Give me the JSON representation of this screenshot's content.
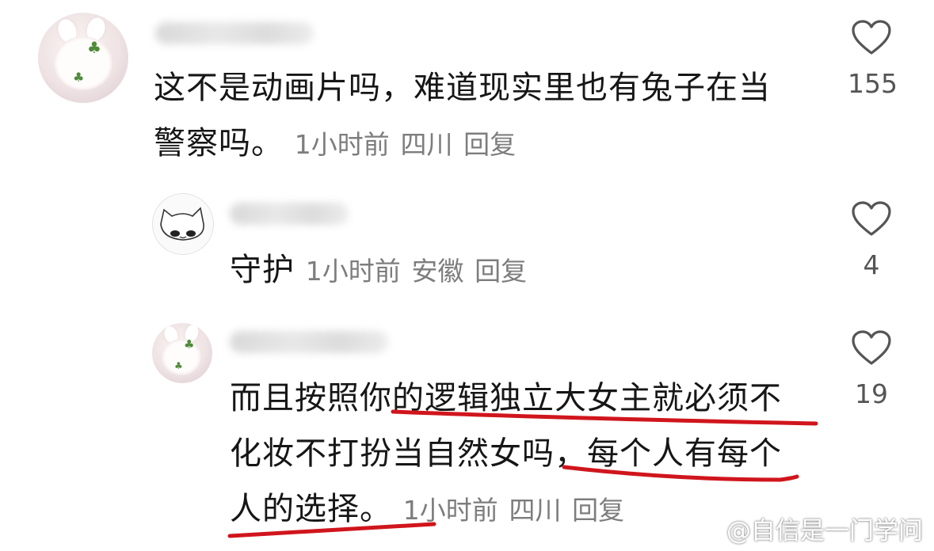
{
  "comments": [
    {
      "text_line1": "这不是动画片吗，难道现实里也有兔子在当",
      "text_line2": "警察吗。",
      "time": "1小时前",
      "location": "四川",
      "reply_label": "回复",
      "like_count": "155",
      "avatar_icon": "bunny-clover-avatar"
    },
    {
      "text_line1": "守护",
      "time": "1小时前",
      "location": "安徽",
      "reply_label": "回复",
      "like_count": "4",
      "avatar_icon": "sketch-cat-avatar"
    },
    {
      "text_line1": "而且按照你的逻辑独立大女主就必须不",
      "text_line2": "化妆不打扮当自然女吗，每个人有每个",
      "text_line3": "人的选择。",
      "time": "1小时前",
      "location": "四川",
      "reply_label": "回复",
      "like_count": "19",
      "avatar_icon": "bunny-clover-avatar"
    }
  ],
  "watermark": "@自信是一门学问",
  "accent_underline_color": "#d0151c"
}
